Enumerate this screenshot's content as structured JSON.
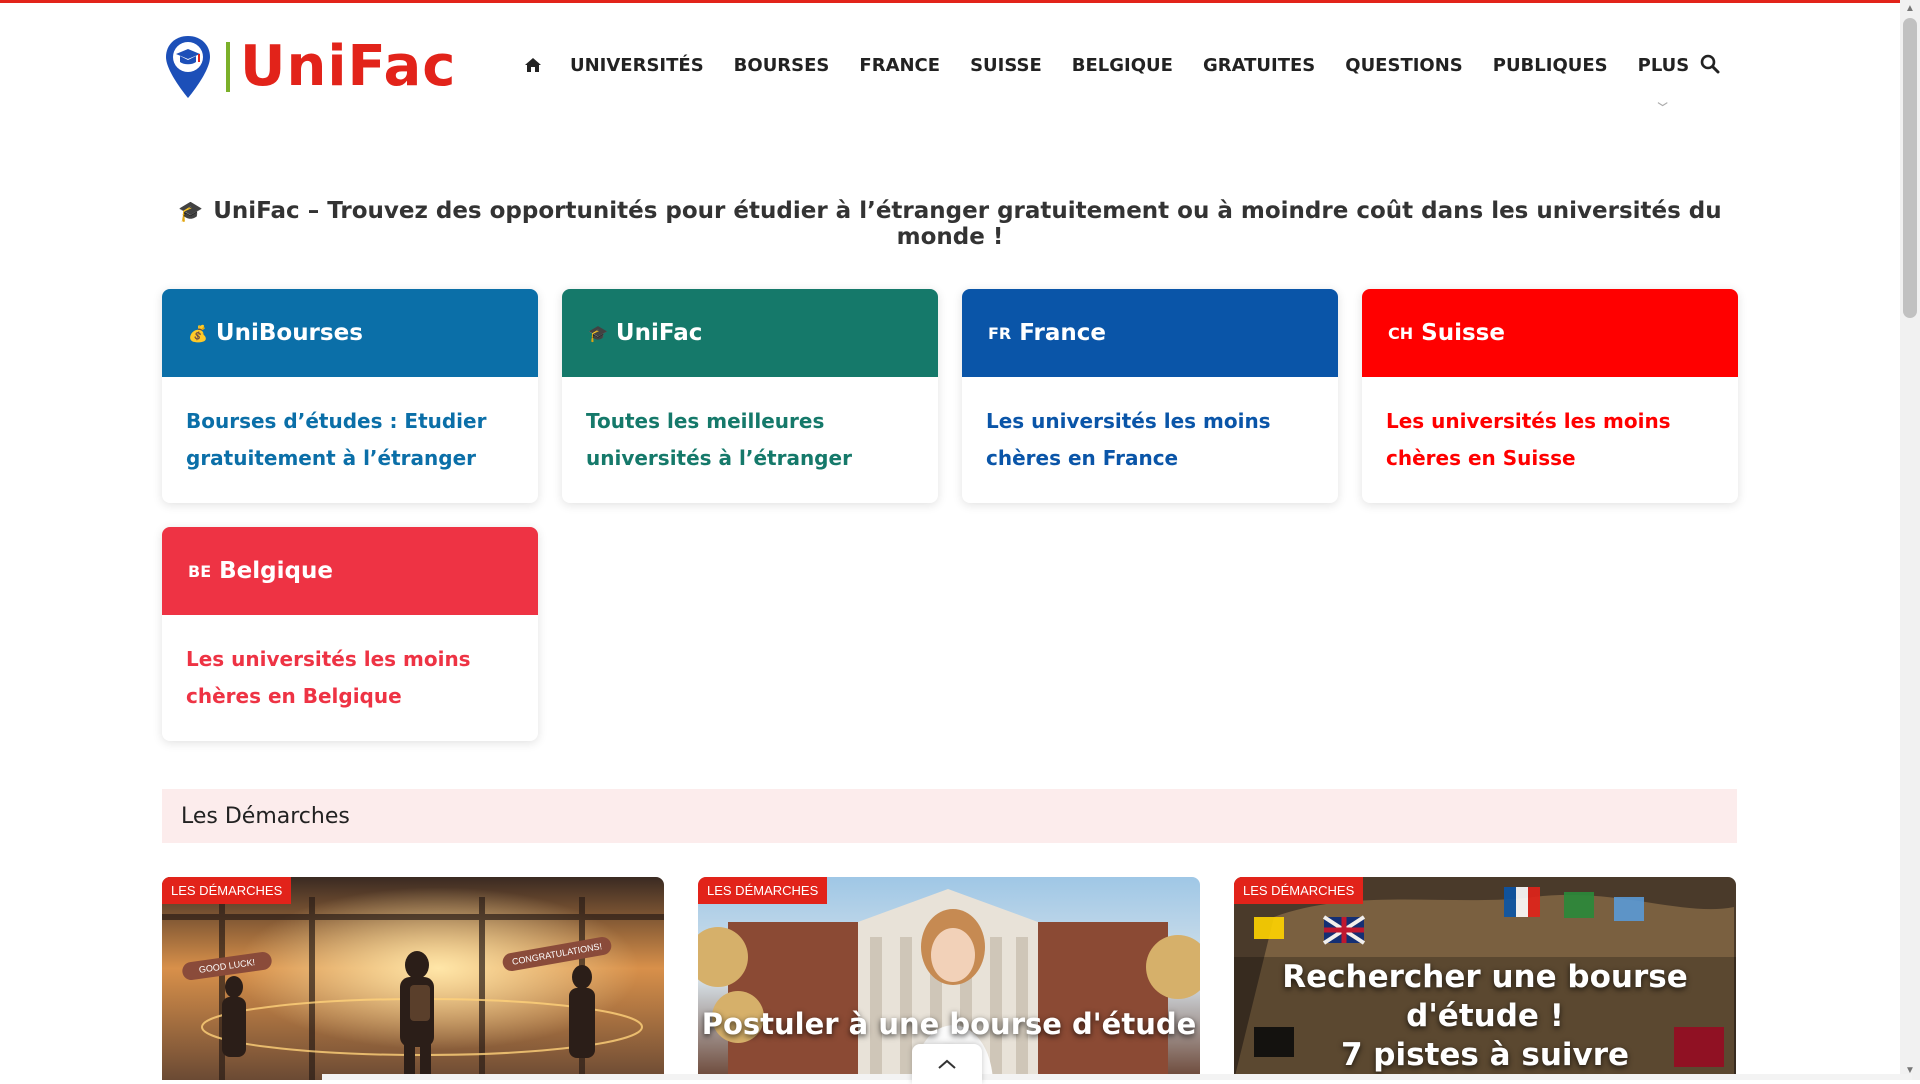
{
  "brand": {
    "name": "UniFac",
    "color": "#e2231a",
    "accent_green": "#7bb02a",
    "pin_color": "#1c4fb8"
  },
  "nav": {
    "home_icon": "home-icon",
    "items": [
      "UNIVERSITÉS",
      "BOURSES",
      "FRANCE",
      "SUISSE",
      "BELGIQUE",
      "GRATUITES",
      "QUESTIONS",
      "PUBLIQUES",
      "PLUS"
    ],
    "search_icon": "search-icon"
  },
  "tagline": {
    "icon": "🎓",
    "text": "UniFac – Trouvez des opportunités pour étudier à l’étranger gratuitement ou à moindre coût dans les universités du monde !"
  },
  "cards": [
    {
      "icon": "💰",
      "title": "UniBourses",
      "link": "Bourses d’études : Etudier gratuitement à l’étranger",
      "head_color": "#0b6fa8",
      "text_color": "#0b6fa8"
    },
    {
      "icon": "🎓",
      "title": "UniFac",
      "link": "Toutes les meilleures universités à l’étranger",
      "head_color": "#15796a",
      "text_color": "#15796a"
    },
    {
      "icon": "FR",
      "title": "France",
      "link": "Les universités les moins chères en France",
      "head_color": "#0a55a8",
      "text_color": "#0a55a8"
    },
    {
      "icon": "CH",
      "title": "Suisse",
      "link": "Les universités les moins chères en Suisse",
      "head_color": "#ff0000",
      "text_color": "#ff0000"
    },
    {
      "icon": "BE",
      "title": "Belgique",
      "link": "Les universités les moins chères en Belgique",
      "head_color": "#ee3344",
      "text_color": "#ee3344"
    }
  ],
  "section": {
    "title": "Les Démarches",
    "bg": "#fcecec"
  },
  "articles": [
    {
      "badge": "LES DÉMARCHES",
      "title": "",
      "sign_left": "GOOD LUCK!",
      "sign_right": "CONGRATULATIONS!"
    },
    {
      "badge": "LES DÉMARCHES",
      "title": "Postuler à une bourse d'étude !"
    },
    {
      "badge": "LES DÉMARCHES",
      "title": "Rechercher une bourse d'étude !",
      "subtitle": "7 pistes à suivre"
    }
  ]
}
